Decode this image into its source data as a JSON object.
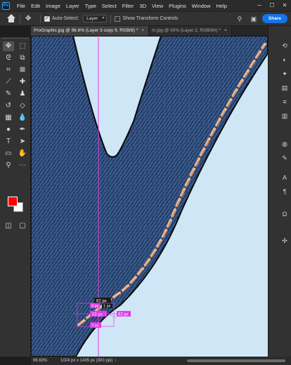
{
  "app": {
    "logo_text": "Ps"
  },
  "menubar": {
    "items": [
      "File",
      "Edit",
      "Image",
      "Layer",
      "Type",
      "Select",
      "Filter",
      "3D",
      "View",
      "Plugins",
      "Window",
      "Help"
    ]
  },
  "window_controls": {
    "minimize": "─",
    "maximize": "☐",
    "close": "✕"
  },
  "options": {
    "auto_select_label": "Auto-Select:",
    "auto_select_checked": true,
    "auto_select_target": "Layer",
    "show_transform_label": "Show Transform Controls",
    "show_transform_checked": false,
    "share_label": "Share"
  },
  "tabs": [
    {
      "label": "ProGraphic.jpg @ 96.6% (Layer 3 copy 9, RGB/8) *",
      "active": true,
      "close": "×"
    },
    {
      "label": "m.jpg @ 50% (Layer 2, RGB/8#) *",
      "active": false,
      "close": "×"
    }
  ],
  "tools": [
    {
      "name": "move-tool",
      "glyph": "✥",
      "active": true
    },
    {
      "name": "marquee-tool",
      "glyph": "⬚"
    },
    {
      "name": "lasso-tool",
      "glyph": "ᘓ"
    },
    {
      "name": "object-selection-tool",
      "glyph": "⧉"
    },
    {
      "name": "crop-tool",
      "glyph": "⌗"
    },
    {
      "name": "frame-tool",
      "glyph": "⊠"
    },
    {
      "name": "eyedropper-tool",
      "glyph": "⟋"
    },
    {
      "name": "healing-brush-tool",
      "glyph": "✚"
    },
    {
      "name": "brush-tool",
      "glyph": "✎"
    },
    {
      "name": "stamp-tool",
      "glyph": "♟"
    },
    {
      "name": "history-brush-tool",
      "glyph": "↺"
    },
    {
      "name": "eraser-tool",
      "glyph": "◇"
    },
    {
      "name": "gradient-tool",
      "glyph": "▦"
    },
    {
      "name": "blur-tool",
      "glyph": "💧"
    },
    {
      "name": "dodge-tool",
      "glyph": "●"
    },
    {
      "name": "pen-tool",
      "glyph": "✒"
    },
    {
      "name": "type-tool",
      "glyph": "T"
    },
    {
      "name": "path-selection-tool",
      "glyph": "➤"
    },
    {
      "name": "shape-tool",
      "glyph": "▭"
    },
    {
      "name": "hand-tool",
      "glyph": "✋"
    },
    {
      "name": "zoom-tool",
      "glyph": "⚲"
    },
    {
      "name": "more-tools",
      "glyph": "⋯"
    }
  ],
  "colors": {
    "foreground": "#ff0000",
    "background": "#ffffff",
    "canvas_bg": "#cfe6f6",
    "stitch": "#f2b78a",
    "guide": "#e23ce6",
    "label_bg": "#e23ce6"
  },
  "measurements": {
    "m1": "62 px",
    "m2": "1 px",
    "m3": "3 px",
    "m4": "62 px",
    "m5": "62 px",
    "m6": "3 px"
  },
  "status": {
    "zoom": "96.63%",
    "doc_info": "1024 px x 1435 px (300 ppi)",
    "arrow": "›"
  },
  "right_panel_icons": [
    "history-icon",
    "adjust-icon",
    "brush-settings-icon",
    "swatches-icon",
    "properties-icon",
    "layers-icon",
    "channels-icon",
    "paths-icon",
    "character-icon",
    "paragraph-icon",
    "glyphs-icon",
    "learn-icon"
  ],
  "right_panel_glyphs": [
    "⟲",
    "◐",
    "✦",
    "▤",
    "≡",
    "▥",
    "◍",
    "✎",
    "A",
    "¶",
    "Ω",
    "✣"
  ]
}
